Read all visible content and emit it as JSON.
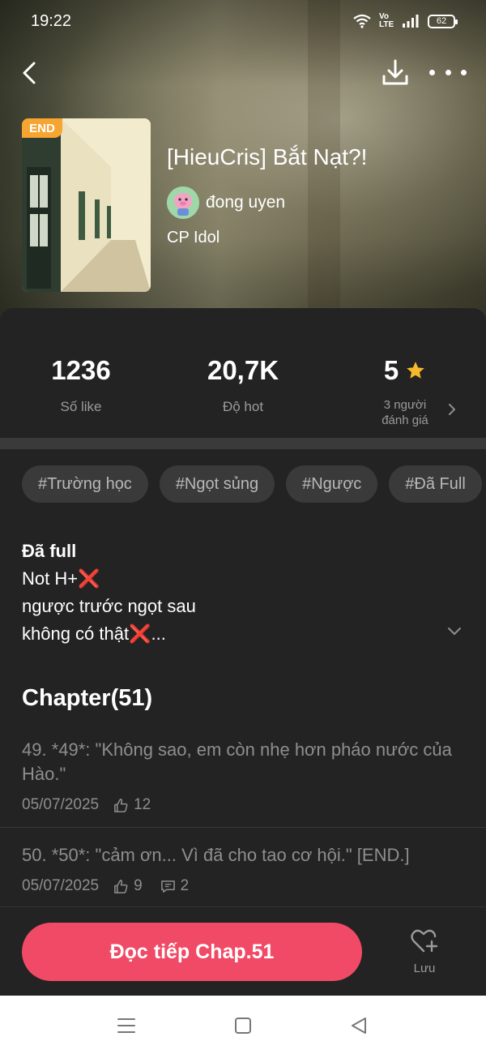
{
  "status_bar": {
    "time": "19:22",
    "net_label": "Vo LTE",
    "battery": "62"
  },
  "book": {
    "badge": "END",
    "title": "[HieuCris] Bắt Nạt?!",
    "author": "đong uyen",
    "category": "CP Idol"
  },
  "stats": {
    "likes_value": "1236",
    "likes_label": "Số like",
    "hot_value": "20,7K",
    "hot_label": "Độ hot",
    "rating_value": "5",
    "rating_label_line1": "3 người",
    "rating_label_line2": "đánh giá"
  },
  "tags": [
    "#Trường học",
    "#Ngọt sủng",
    "#Ngược",
    "#Đã Full"
  ],
  "description": {
    "line1": "Đã full",
    "line2": "Not H+",
    "line3": "ngược trước ngọt sau",
    "line4": "không có thật",
    "line4_suffix": "...",
    "x_mark": "❌"
  },
  "chapters": {
    "heading": "Chapter(51)",
    "items": [
      {
        "title": "49. *49*: \"Không sao, em còn nhẹ hơn pháo nước của Hào.\"",
        "date": "05/07/2025",
        "likes": "12"
      },
      {
        "title": "50. *50*: \"cảm ơn... Vì đã cho tao cơ hội.\" [END.]",
        "date": "05/07/2025",
        "likes": "9",
        "comments": "2"
      }
    ]
  },
  "actions": {
    "read_label": "Đọc tiếp Chap.51",
    "save_label": "Lưu"
  },
  "colors": {
    "accent": "#f04a66",
    "badge": "#f6a531",
    "star": "#f6b92b",
    "x_mark": "#e6392f",
    "panel_bg": "#232323"
  }
}
